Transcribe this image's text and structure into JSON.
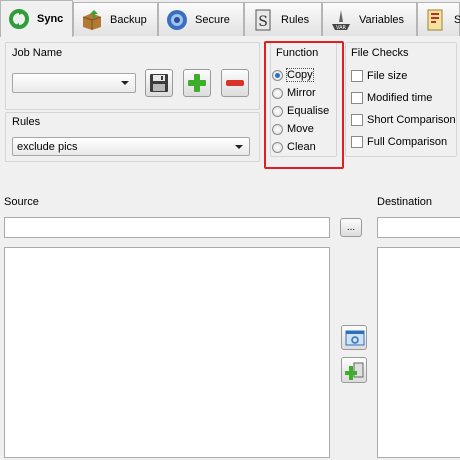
{
  "tabs": [
    {
      "label": "Sync",
      "icon": "sync-icon",
      "active": true
    },
    {
      "label": "Backup",
      "icon": "backup-box-icon",
      "active": false
    },
    {
      "label": "Secure",
      "icon": "secure-shield-icon",
      "active": false
    },
    {
      "label": "Rules",
      "icon": "rules-icon",
      "active": false
    },
    {
      "label": "Variables",
      "icon": "variables-icon",
      "active": false
    },
    {
      "label": "S",
      "icon": "script-icon",
      "active": false
    }
  ],
  "job": {
    "title": "Job Name",
    "value": "",
    "save_icon": "floppy-save-icon",
    "add_icon": "green-plus-icon",
    "remove_icon": "red-minus-icon"
  },
  "rules": {
    "title": "Rules",
    "value": "exclude pics"
  },
  "function": {
    "title": "Function",
    "options": [
      "Copy",
      "Mirror",
      "Equalise",
      "Move",
      "Clean"
    ],
    "selected": "Copy",
    "highlight_color": "#e02020"
  },
  "file_checks": {
    "title": "File Checks",
    "options": [
      "File size",
      "Modified time",
      "Short Comparison",
      "Full Comparison"
    ]
  },
  "source": {
    "label": "Source",
    "path": "",
    "browse_label": "..."
  },
  "destination": {
    "label": "Destination",
    "path": ""
  },
  "preview_icon": "preview-window-icon",
  "add_dest_icon": "add-destination-icon"
}
